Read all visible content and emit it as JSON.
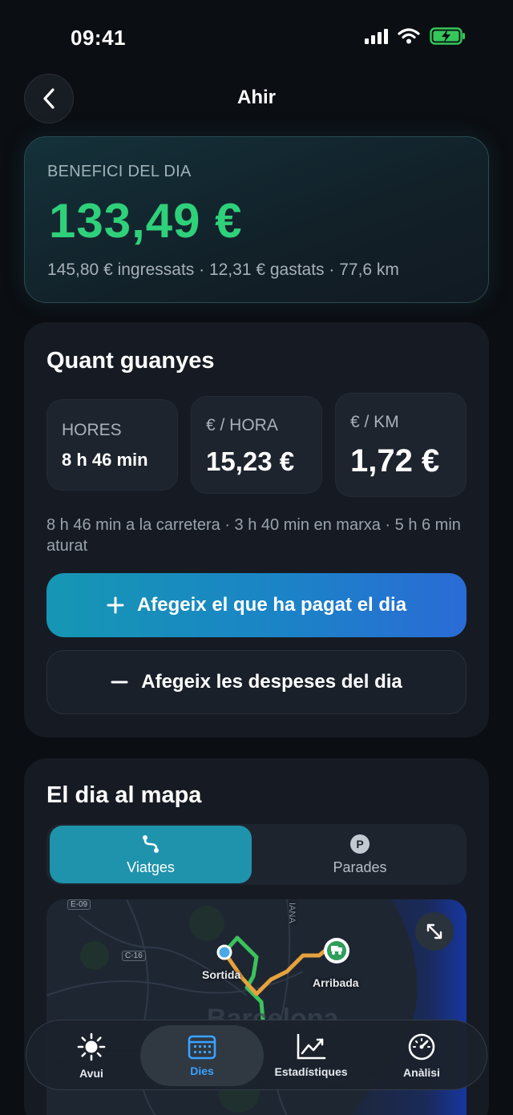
{
  "status": {
    "time": "09:41"
  },
  "header": {
    "title": "Ahir"
  },
  "profit": {
    "label": "BENEFICI DEL DIA",
    "value": "133,49 €",
    "summary": "145,80 € ingressats · 12,31 € gastats · 77,6 km",
    "color": "#2fd07a"
  },
  "earnings": {
    "title": "Quant guanyes",
    "metrics": [
      {
        "label": "HORES",
        "value": "8 h 46 min"
      },
      {
        "label": "€ / HORA",
        "value": "15,23 €"
      },
      {
        "label": "€ / KM",
        "value": "1,72 €"
      }
    ],
    "detail": "8 h 46 min a la carretera · 3 h 40 min en marxa · 5 h 6 min aturat",
    "add_income_label": "Afegeix el que ha pagat el dia",
    "add_expense_label": "Afegeix les despeses del dia"
  },
  "map_section": {
    "title": "El dia al mapa",
    "tabs": [
      {
        "label": "Viatges",
        "icon": "route-icon",
        "active": true
      },
      {
        "label": "Parades",
        "icon": "parking-icon",
        "active": false
      }
    ],
    "start_label": "Sortida",
    "end_label": "Arribada",
    "road_tags": [
      "E-09",
      "C-16"
    ],
    "street_label": "IANA"
  },
  "tabbar": {
    "items": [
      {
        "label": "Avui",
        "icon": "sun-icon"
      },
      {
        "label": "Dies",
        "icon": "calendar-icon",
        "active": true
      },
      {
        "label": "Estadístiques",
        "icon": "chart-icon"
      },
      {
        "label": "Anàlisi",
        "icon": "speedometer-icon"
      }
    ]
  }
}
